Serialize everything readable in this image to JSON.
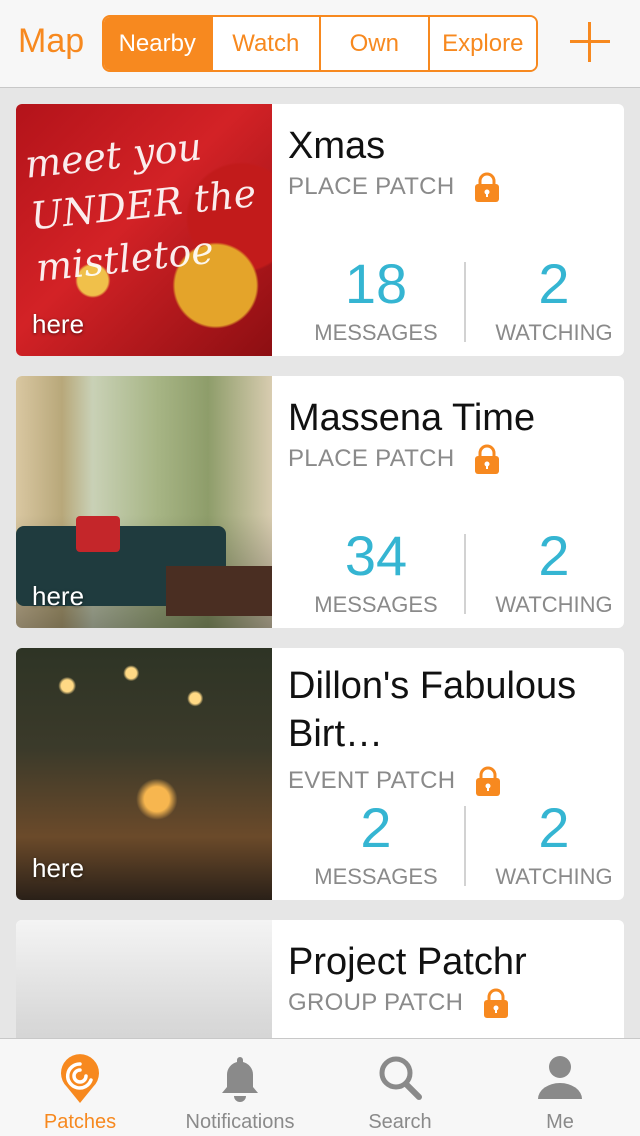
{
  "header": {
    "map_label": "Map",
    "segments": [
      {
        "label": "Nearby",
        "active": true
      },
      {
        "label": "Watch",
        "active": false
      },
      {
        "label": "Own",
        "active": false
      },
      {
        "label": "Explore",
        "active": false
      }
    ],
    "add_icon": "plus-icon"
  },
  "colors": {
    "accent": "#f7891f",
    "count": "#35b5d2",
    "muted": "#8a8a8a"
  },
  "patches": [
    {
      "title": "Xmas",
      "type": "PLACE PATCH",
      "image_caption": "here",
      "image_text": "meet you UNDER the mistletoe",
      "messages": "18",
      "messages_label": "MESSAGES",
      "watching": "2",
      "watching_label": "WATCHING",
      "locked": true
    },
    {
      "title": "Massena Time",
      "type": "PLACE PATCH",
      "image_caption": "here",
      "messages": "34",
      "messages_label": "MESSAGES",
      "watching": "2",
      "watching_label": "WATCHING",
      "locked": true
    },
    {
      "title": "Dillon's Fabulous Birt…",
      "type": "EVENT PATCH",
      "image_caption": "here",
      "messages": "2",
      "messages_label": "MESSAGES",
      "watching": "2",
      "watching_label": "WATCHING",
      "locked": true
    },
    {
      "title": "Project Patchr",
      "type": "GROUP PATCH",
      "locked": true
    }
  ],
  "tabbar": [
    {
      "label": "Patches",
      "icon": "patches-icon",
      "active": true
    },
    {
      "label": "Notifications",
      "icon": "bell-icon",
      "active": false
    },
    {
      "label": "Search",
      "icon": "search-icon",
      "active": false
    },
    {
      "label": "Me",
      "icon": "person-icon",
      "active": false
    }
  ]
}
